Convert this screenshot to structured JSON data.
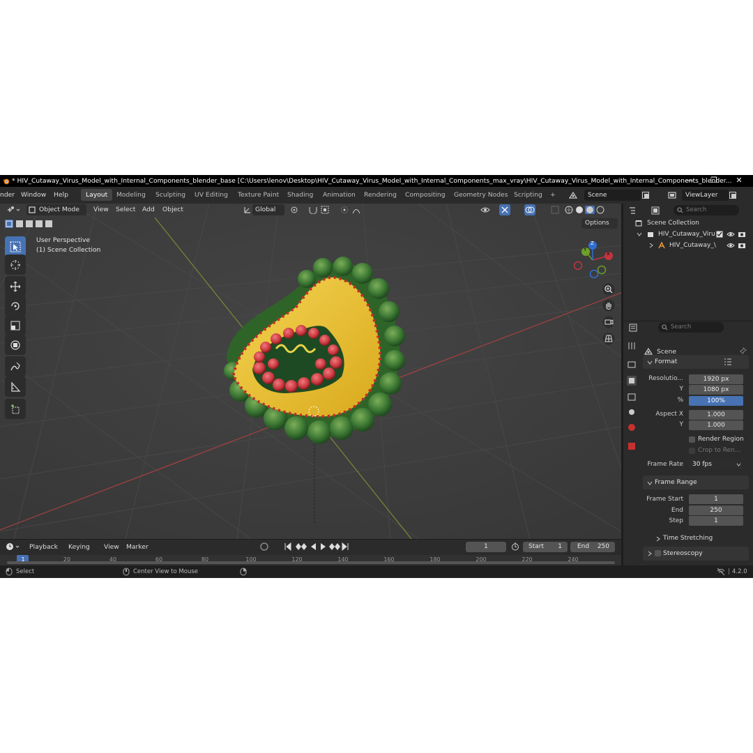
{
  "window": {
    "title": "* HIV_Cutaway_Virus_Model_with_Internal_Components_blender_base [C:\\Users\\lenov\\Desktop\\HIV_Cutaway_Virus_Model_with_Internal_Components_max_vray\\HIV_Cutaway_Virus_Model_with_Internal_Components_blender...",
    "minimize": "—",
    "maximize": "❐",
    "close": "✕"
  },
  "menu": [
    "nder",
    "Window",
    "Help"
  ],
  "workspaces": [
    "Layout",
    "Modeling",
    "Sculpting",
    "UV Editing",
    "Texture Paint",
    "Shading",
    "Animation",
    "Rendering",
    "Compositing",
    "Geometry Nodes",
    "Scripting",
    "+"
  ],
  "scene_field": "Scene",
  "viewlayer_field": "ViewLayer",
  "viewport": {
    "mode": "Object Mode",
    "header_menus": [
      "View",
      "Select",
      "Add",
      "Object"
    ],
    "transform_orientation": "Global",
    "overlay_text_1": "User Perspective",
    "overlay_text_2": "(1) Scene Collection",
    "options_label": "Options",
    "gizmo_axes": [
      "X",
      "Y",
      "Z"
    ]
  },
  "outliner": {
    "search_placeholder": "Search",
    "root": "Scene Collection",
    "items": [
      "HIV_Cutaway_Viru",
      "HIV_Cutaway_\\"
    ]
  },
  "properties": {
    "search_placeholder": "Search",
    "context": "Scene",
    "format_section": "Format",
    "resolution_x_label": "Resolutio...",
    "resolution_x": "1920 px",
    "resolution_y_label": "Y",
    "resolution_y": "1080 px",
    "percent_label": "%",
    "percent": "100%",
    "aspect_x_label": "Aspect X",
    "aspect_x": "1.000",
    "aspect_y_label": "Y",
    "aspect_y": "1.000",
    "render_region": "Render Region",
    "crop_to_render": "Crop to Ren...",
    "frame_rate_label": "Frame Rate",
    "frame_rate": "30 fps",
    "frame_range_section": "Frame Range",
    "frame_start_label": "Frame Start",
    "frame_start": "1",
    "end_label": "End",
    "end": "250",
    "step_label": "Step",
    "step": "1",
    "time_stretching": "Time Stretching",
    "stereoscopy": "Stereoscopy"
  },
  "timeline": {
    "menus": [
      "Playback",
      "Keying",
      "View",
      "Marker"
    ],
    "current_frame": "1",
    "start_label": "Start",
    "start": "1",
    "end_label": "End",
    "end": "250",
    "ruler": [
      "1",
      "20",
      "40",
      "60",
      "80",
      "100",
      "120",
      "140",
      "160",
      "180",
      "200",
      "220",
      "240"
    ]
  },
  "status": {
    "select": "Select",
    "center_view": "Center View to Mouse",
    "version": "4.2.0"
  },
  "colors": {
    "accent": "#4772b3",
    "virus_outer": "#3f7a35",
    "virus_inner": "#e6c12a",
    "virus_core": "#c8353c"
  }
}
